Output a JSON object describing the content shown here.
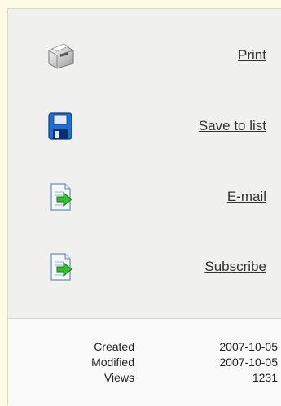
{
  "actions": [
    {
      "label": "Print",
      "icon": "printer-icon"
    },
    {
      "label": "Save to list",
      "icon": "floppy-disk-icon"
    },
    {
      "label": "E-mail",
      "icon": "document-arrow-icon"
    },
    {
      "label": "Subscribe",
      "icon": "document-arrow-icon"
    }
  ],
  "info": {
    "created_label": "Created",
    "created_value": "2007-10-05",
    "modified_label": "Modified",
    "modified_value": "2007-10-05",
    "views_label": "Views",
    "views_value": "1231"
  },
  "colors": {
    "page_background": "#fdfbe4",
    "panel_background": "#f0f0ee",
    "info_background": "#fafafa",
    "floppy_blue": "#1e6fcf",
    "arrow_green": "#2fbf2f"
  }
}
